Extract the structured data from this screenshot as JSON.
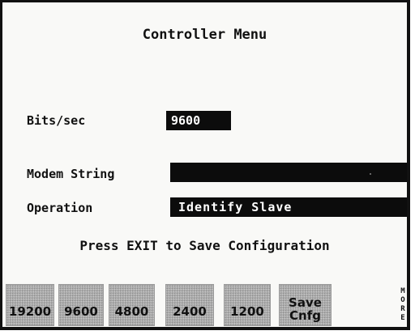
{
  "screen": {
    "title": "Controller Menu",
    "bits_label": "Bits/sec",
    "bits_value": "9600",
    "modem_label": "Modem String",
    "modem_value": "",
    "operation_label": "Operation",
    "operation_value": "Identify Slave",
    "message": "Press EXIT to Save Configuration"
  },
  "softkeys": {
    "k1": "19200",
    "k2": "9600",
    "k3": "4800",
    "k4": "2400",
    "k5": "1200",
    "k6_line1": "Save",
    "k6_line2": "Cnfg",
    "more": [
      "M",
      "O",
      "R",
      "E"
    ]
  }
}
